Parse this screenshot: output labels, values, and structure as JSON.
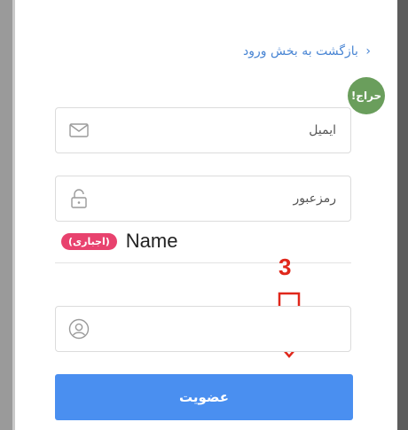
{
  "header": {
    "back_link": "بازگشت به بخش ورود",
    "back_chevron": "‹"
  },
  "badge": {
    "label": "حراج!",
    "color": "#6a9e5c"
  },
  "form": {
    "email_placeholder": "ایمیل",
    "password_placeholder": "رمزعبور",
    "name_label": "Name",
    "required_label": "(اجباری)",
    "username_placeholder": "",
    "submit_label": "عضویت"
  },
  "annotation": {
    "step_number": "3"
  },
  "colors": {
    "accent": "#4a8ff0",
    "link": "#4a86d4",
    "required": "#e8426e",
    "annotation": "#e0271b"
  },
  "icons": [
    "mail-icon",
    "lock-icon",
    "user-icon",
    "down-arrow-icon"
  ]
}
